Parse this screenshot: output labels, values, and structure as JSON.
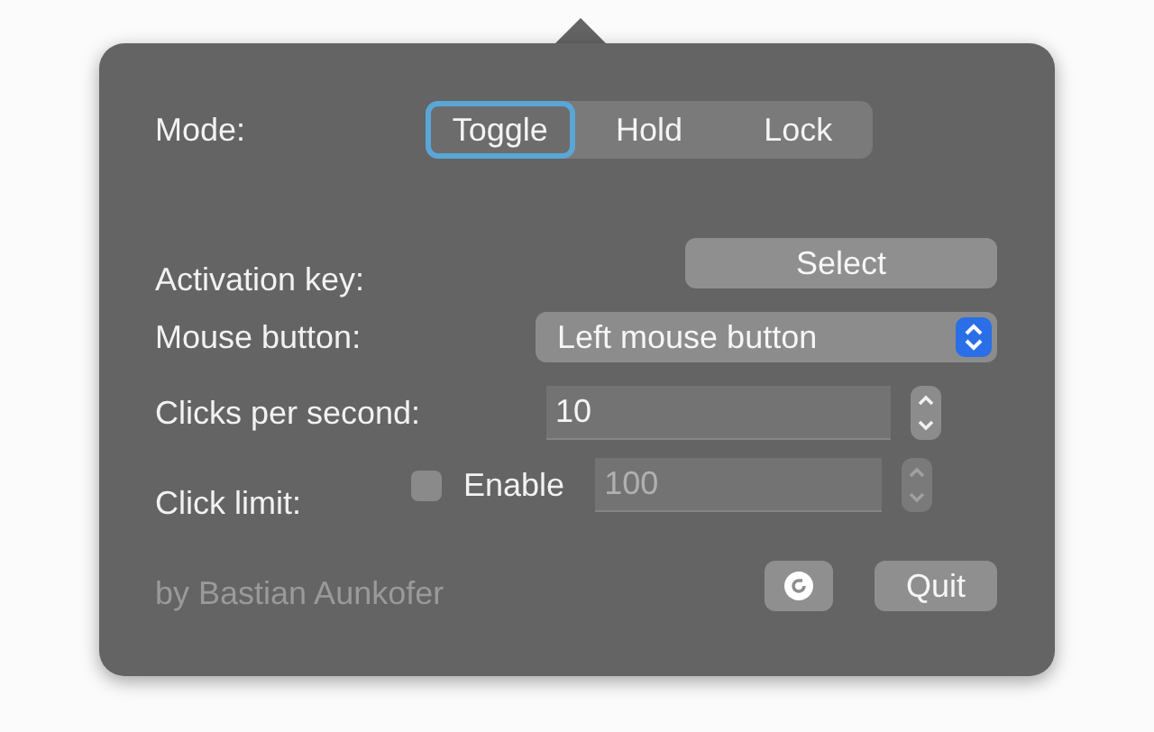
{
  "mode": {
    "label": "Mode:",
    "options": [
      {
        "label": "Toggle",
        "selected": true
      },
      {
        "label": "Hold",
        "selected": false
      },
      {
        "label": "Lock",
        "selected": false
      }
    ]
  },
  "activation_key": {
    "label": "Activation key:",
    "button": "Select"
  },
  "mouse_button": {
    "label": "Mouse button:",
    "value": "Left mouse button"
  },
  "clicks_per_second": {
    "label": "Clicks per second:",
    "value": "10"
  },
  "click_limit": {
    "label": "Click limit:",
    "checkbox": {
      "label": "Enable",
      "checked": false
    },
    "placeholder": "100",
    "disabled": true
  },
  "footer": {
    "credit": "by Bastian Aunkofer",
    "quit": "Quit"
  }
}
